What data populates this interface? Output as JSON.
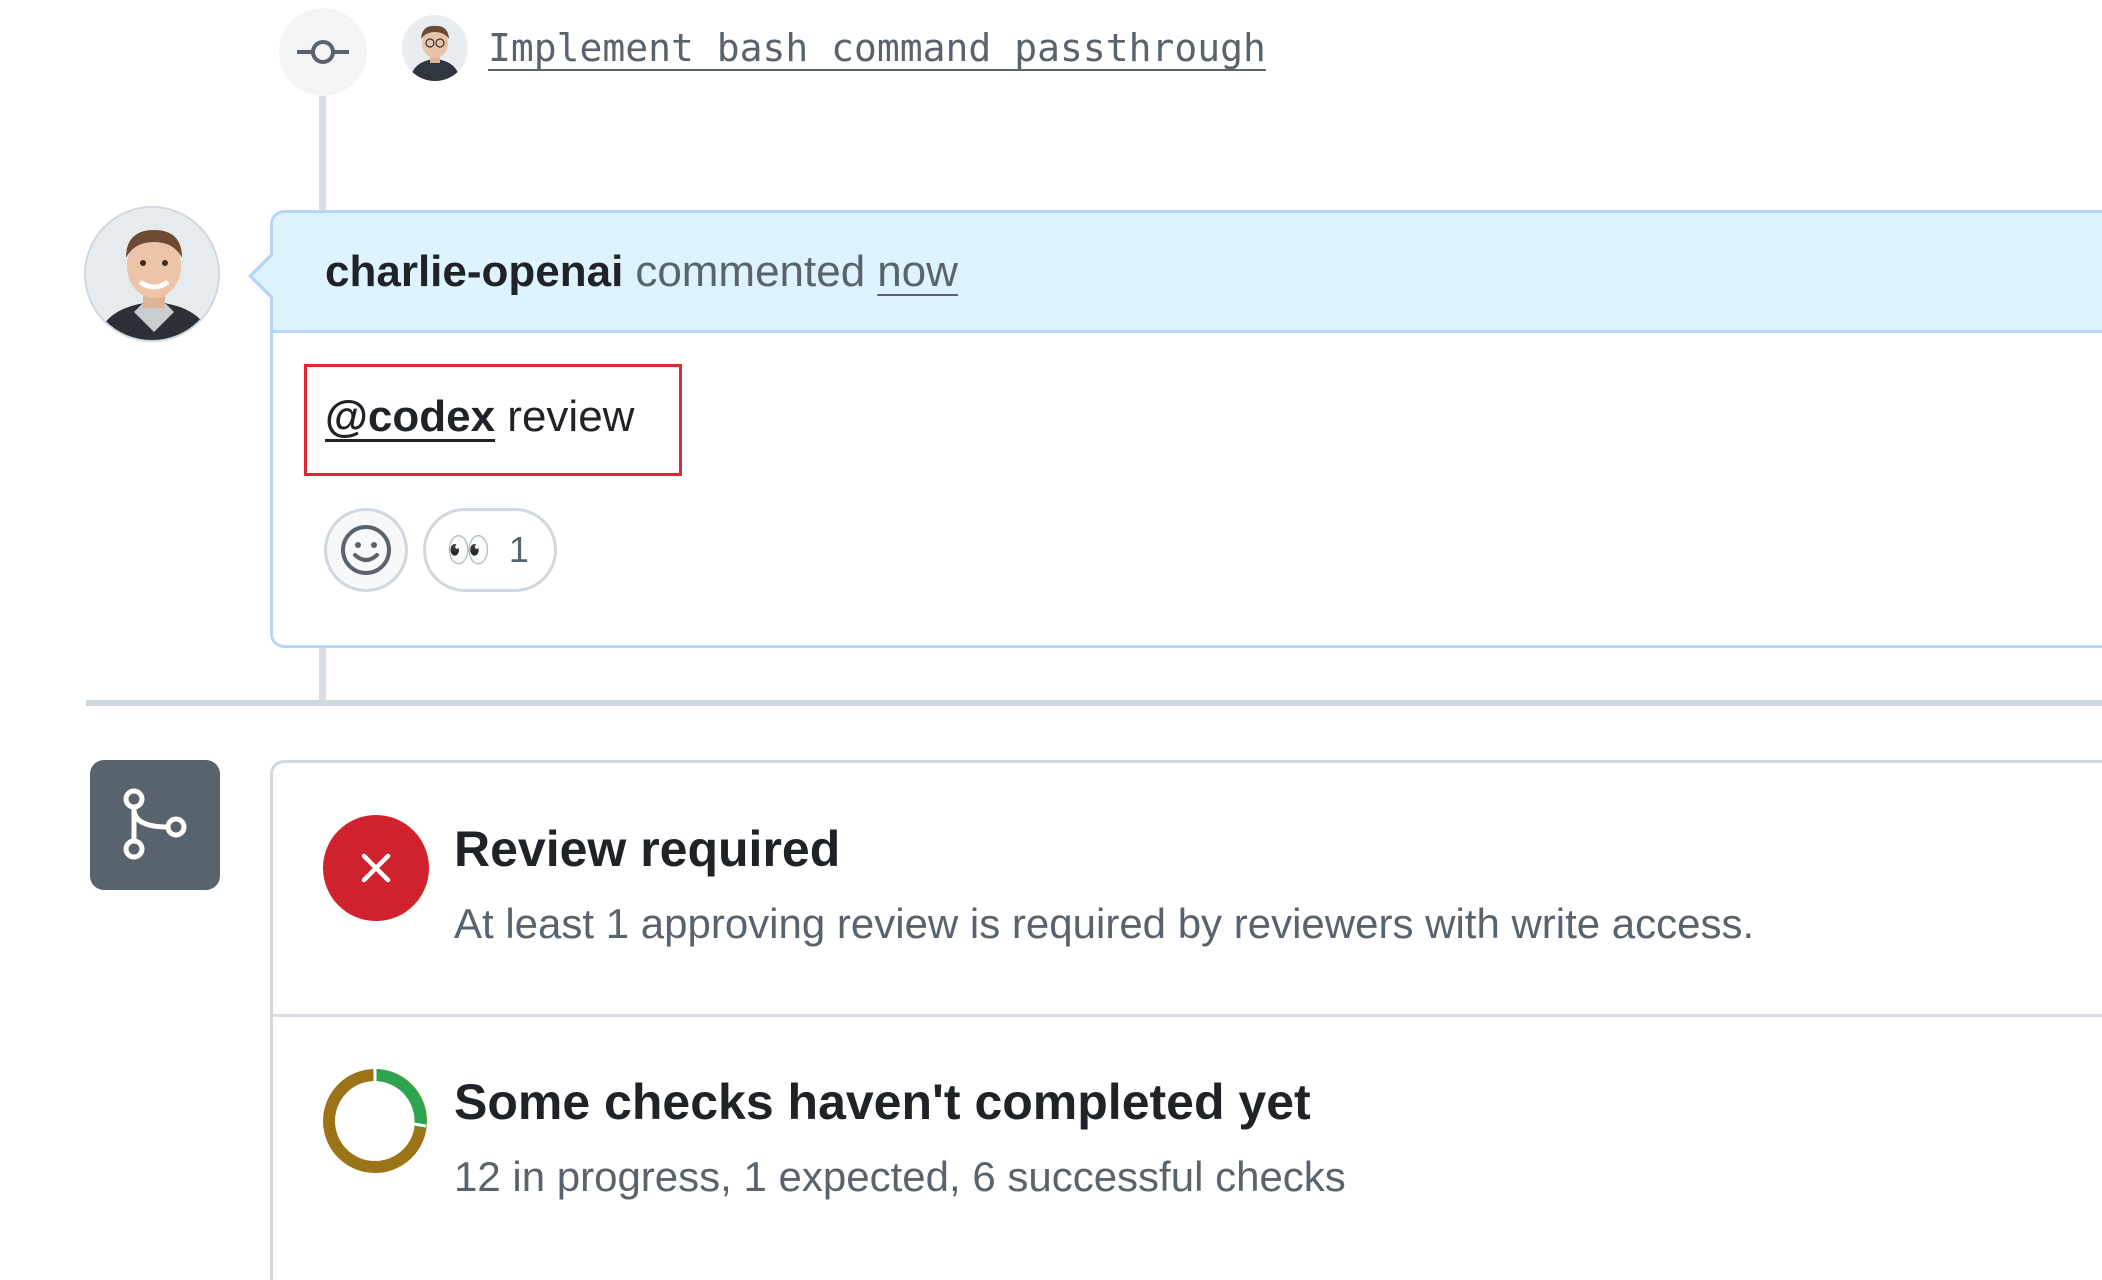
{
  "commit": {
    "message": "Implement bash command passthrough",
    "icon": "git-commit-icon"
  },
  "comment": {
    "author": "charlie-openai",
    "action": "commented",
    "time": "now",
    "mention": "@codex",
    "body_text": " review",
    "reactions": [
      {
        "emoji": "👀",
        "count": "1"
      }
    ]
  },
  "merge_box": {
    "icon": "git-branch-icon",
    "rows": [
      {
        "title": "Review required",
        "subtitle": "At least 1 approving review is required by reviewers with write access.",
        "status": "failed",
        "color": "#cf222e"
      },
      {
        "title": "Some checks haven't completed yet",
        "subtitle": "12 in progress, 1 expected, 6 successful checks",
        "status": "pending",
        "colors": {
          "success": "#2da44e",
          "pending": "#9a6700"
        }
      }
    ]
  }
}
